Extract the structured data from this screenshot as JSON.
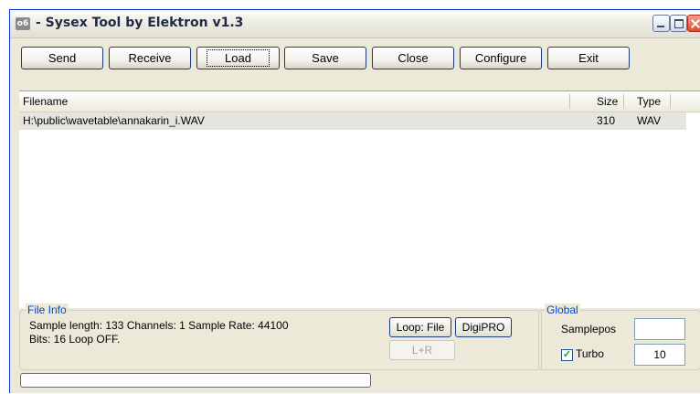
{
  "window": {
    "title": "- Sysex Tool by Elektron v1.3",
    "app_icon": "elektron-app-icon"
  },
  "toolbar": {
    "buttons": [
      {
        "label": "Send"
      },
      {
        "label": "Receive"
      },
      {
        "label": "Load"
      },
      {
        "label": "Save"
      },
      {
        "label": "Close"
      },
      {
        "label": "Configure"
      },
      {
        "label": "Exit"
      }
    ],
    "focused": "Load"
  },
  "file_list": {
    "columns": [
      "Filename",
      "Size",
      "Type"
    ],
    "rows": [
      {
        "filename": "H:\\public\\wavetable\\annakarin_i.WAV",
        "size": "310",
        "type": "WAV"
      }
    ]
  },
  "file_info": {
    "legend": "File Info",
    "line1": "Sample length: 133 Channels: 1 Sample Rate: 44100",
    "line2": "Bits: 16 Loop OFF.",
    "loop_button": "Loop: File",
    "digipro_button": "DigiPRO",
    "lr_button": "L+R"
  },
  "global": {
    "legend": "Global",
    "samplepos_label": "Samplepos",
    "samplepos_value": "",
    "turbo_label": "Turbo",
    "turbo_checked": true,
    "turbo_value": "10"
  },
  "status": {
    "progress": 0.0
  },
  "colors": {
    "legend_blue": "#0046d5",
    "progress_green": "#2a9e2a",
    "window_bg": "#ece9d8"
  }
}
